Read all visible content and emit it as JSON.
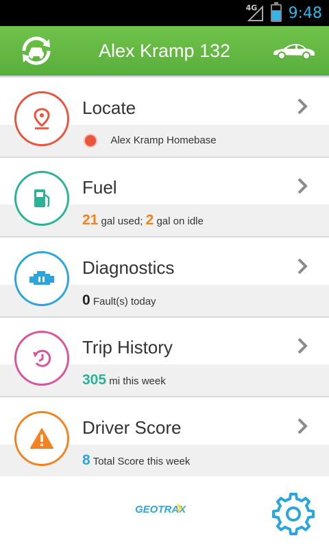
{
  "status_bar": {
    "network": "4G",
    "time": "9:48"
  },
  "header": {
    "title": "Alex Kramp 132"
  },
  "cards": [
    {
      "title": "Locate",
      "color": "#e8553d",
      "icon": "location-pin-icon",
      "detail": "Alex Kramp Homebase",
      "dot_color": "#e8553d"
    },
    {
      "title": "Fuel",
      "color": "#2bb39a",
      "icon": "fuel-pump-icon",
      "value1": "21",
      "text1": "gal used;",
      "value2": "2",
      "text2": "gal on idle",
      "value_color": "#f58220"
    },
    {
      "title": "Diagnostics",
      "color": "#2aa6dd",
      "icon": "engine-icon",
      "value1": "0",
      "text1": "Fault(s) today",
      "value_color": "#222222"
    },
    {
      "title": "Trip History",
      "color": "#d9549a",
      "icon": "history-icon",
      "value1": "305",
      "text1": "mi this week",
      "value_color": "#2bb39a"
    },
    {
      "title": "Driver Score",
      "color": "#f58220",
      "icon": "warning-icon",
      "value1": "8",
      "text1": "Total Score this week",
      "value_color": "#2aa6dd"
    }
  ],
  "footer": {
    "logo_text": "GEOTRAX"
  }
}
